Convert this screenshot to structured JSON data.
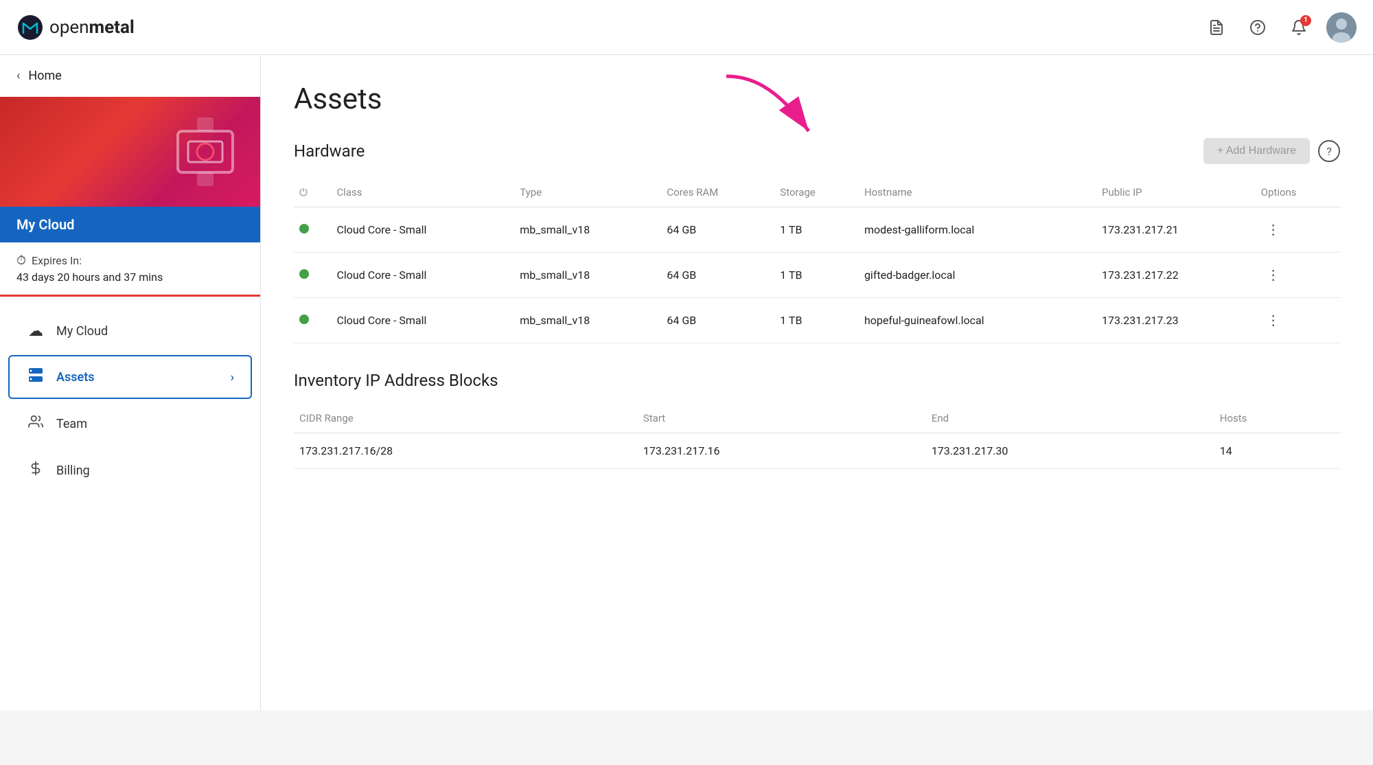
{
  "header": {
    "logo_text_open": "open",
    "logo_text_metal": "metal",
    "notification_count": "1",
    "avatar_initials": "👤"
  },
  "sidebar": {
    "home_label": "Home",
    "my_cloud_label": "My Cloud",
    "expires_label": "Expires In:",
    "expires_time": "43 days 20 hours and 37 mins",
    "nav_items": [
      {
        "id": "my-cloud",
        "label": "My Cloud",
        "icon": "☁",
        "active": false,
        "has_arrow": false
      },
      {
        "id": "assets",
        "label": "Assets",
        "icon": "▤",
        "active": true,
        "has_arrow": true
      },
      {
        "id": "team",
        "label": "Team",
        "icon": "👥",
        "active": false,
        "has_arrow": false
      },
      {
        "id": "billing",
        "label": "Billing",
        "icon": "🏛",
        "active": false,
        "has_arrow": false
      }
    ]
  },
  "main": {
    "page_title": "Assets",
    "hardware": {
      "section_title": "Hardware",
      "add_button_label": "+ Add Hardware",
      "table_headers": [
        "",
        "Class",
        "Type",
        "Cores RAM",
        "Storage",
        "Hostname",
        "Public IP",
        "Options"
      ],
      "rows": [
        {
          "status": "active",
          "class": "Cloud Core - Small",
          "type": "mb_small_v18",
          "cores": "64 GB",
          "storage": "1 TB",
          "hostname": "modest-galliform.local",
          "public_ip": "173.231.217.21"
        },
        {
          "status": "active",
          "class": "Cloud Core - Small",
          "type": "mb_small_v18",
          "cores": "64 GB",
          "storage": "1 TB",
          "hostname": "gifted-badger.local",
          "public_ip": "173.231.217.22"
        },
        {
          "status": "active",
          "class": "Cloud Core - Small",
          "type": "mb_small_v18",
          "cores": "64 GB",
          "storage": "1 TB",
          "hostname": "hopeful-guineafowl.local",
          "public_ip": "173.231.217.23"
        }
      ]
    },
    "inventory": {
      "section_title": "Inventory IP Address Blocks",
      "table_headers": [
        "CIDR Range",
        "Start",
        "End",
        "Hosts"
      ],
      "rows": [
        {
          "cidr": "173.231.217.16/28",
          "start": "173.231.217.16",
          "end": "173.231.217.30",
          "hosts": "14"
        }
      ]
    }
  }
}
